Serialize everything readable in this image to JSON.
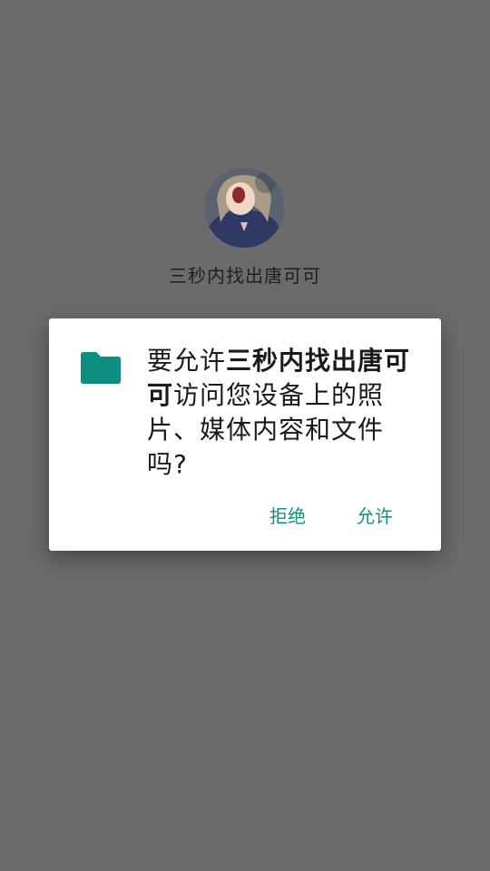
{
  "app": {
    "name": "三秒内找出唐可可"
  },
  "dialog": {
    "prefix": "要允许",
    "app_name": "三秒内找出唐可可",
    "suffix": "访问您设备上的照片、媒体内容和文件吗?",
    "deny_label": "拒绝",
    "allow_label": "允许",
    "icon": "folder-icon",
    "accent_color": "#138f85",
    "icon_color": "#0f8f83"
  },
  "colors": {
    "scrim": "#6b6b6b",
    "dialog_bg": "#ffffff"
  }
}
